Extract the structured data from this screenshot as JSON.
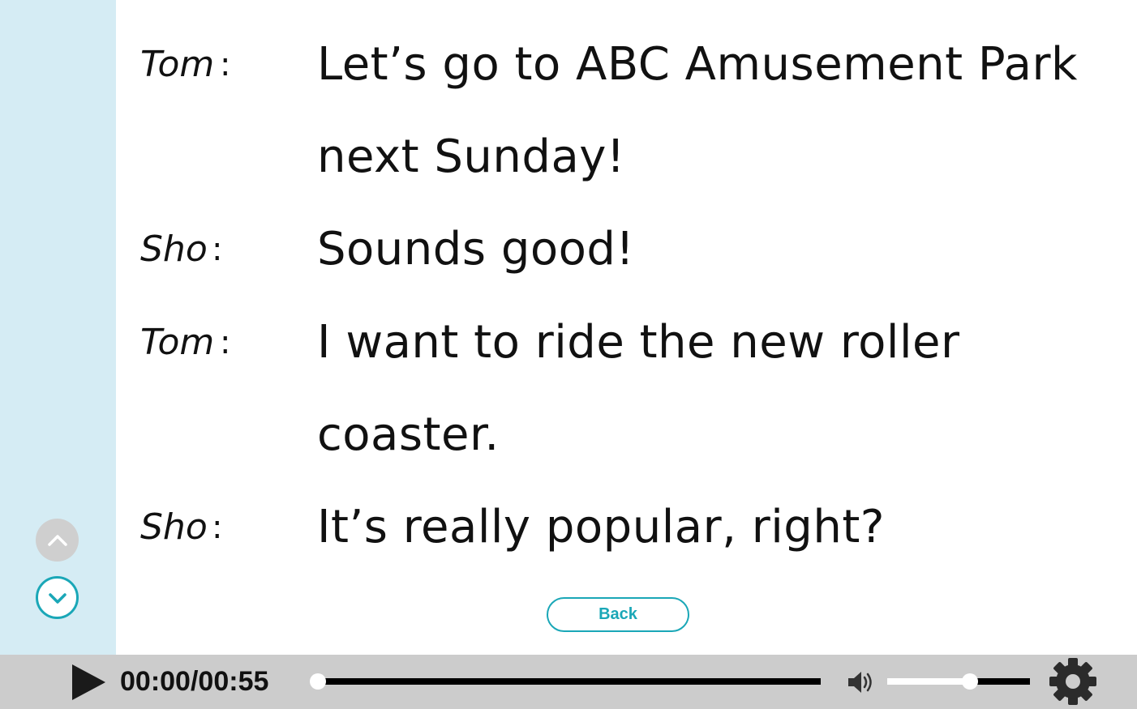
{
  "dialogue": [
    {
      "speaker": "Tom",
      "colon": ":",
      "lines": [
        "Let’s go to ABC Amusement Park",
        "next Sunday!"
      ]
    },
    {
      "speaker": "Sho",
      "colon": ":",
      "lines": [
        "Sounds good!"
      ]
    },
    {
      "speaker": "Tom",
      "colon": ":",
      "lines": [
        "I want to ride the new roller",
        "coaster."
      ]
    },
    {
      "speaker": "Sho",
      "colon": ":",
      "lines": [
        "It’s really popular, right?"
      ]
    }
  ],
  "back_button": {
    "label": "Back"
  },
  "player": {
    "current_time": "00:00",
    "separator": "/",
    "duration": "00:55",
    "progress_fraction": 0.0,
    "volume_fraction": 0.58,
    "play_icon": "play-icon",
    "volume_icon": "speaker-volume-icon",
    "settings_icon": "gear-icon"
  },
  "scroll": {
    "up_icon": "chevron-up-icon",
    "down_icon": "chevron-down-icon"
  },
  "colors": {
    "accent": "#1aa7b7",
    "sidebar": "#d5ecf4",
    "player_bar": "#cccccc"
  }
}
